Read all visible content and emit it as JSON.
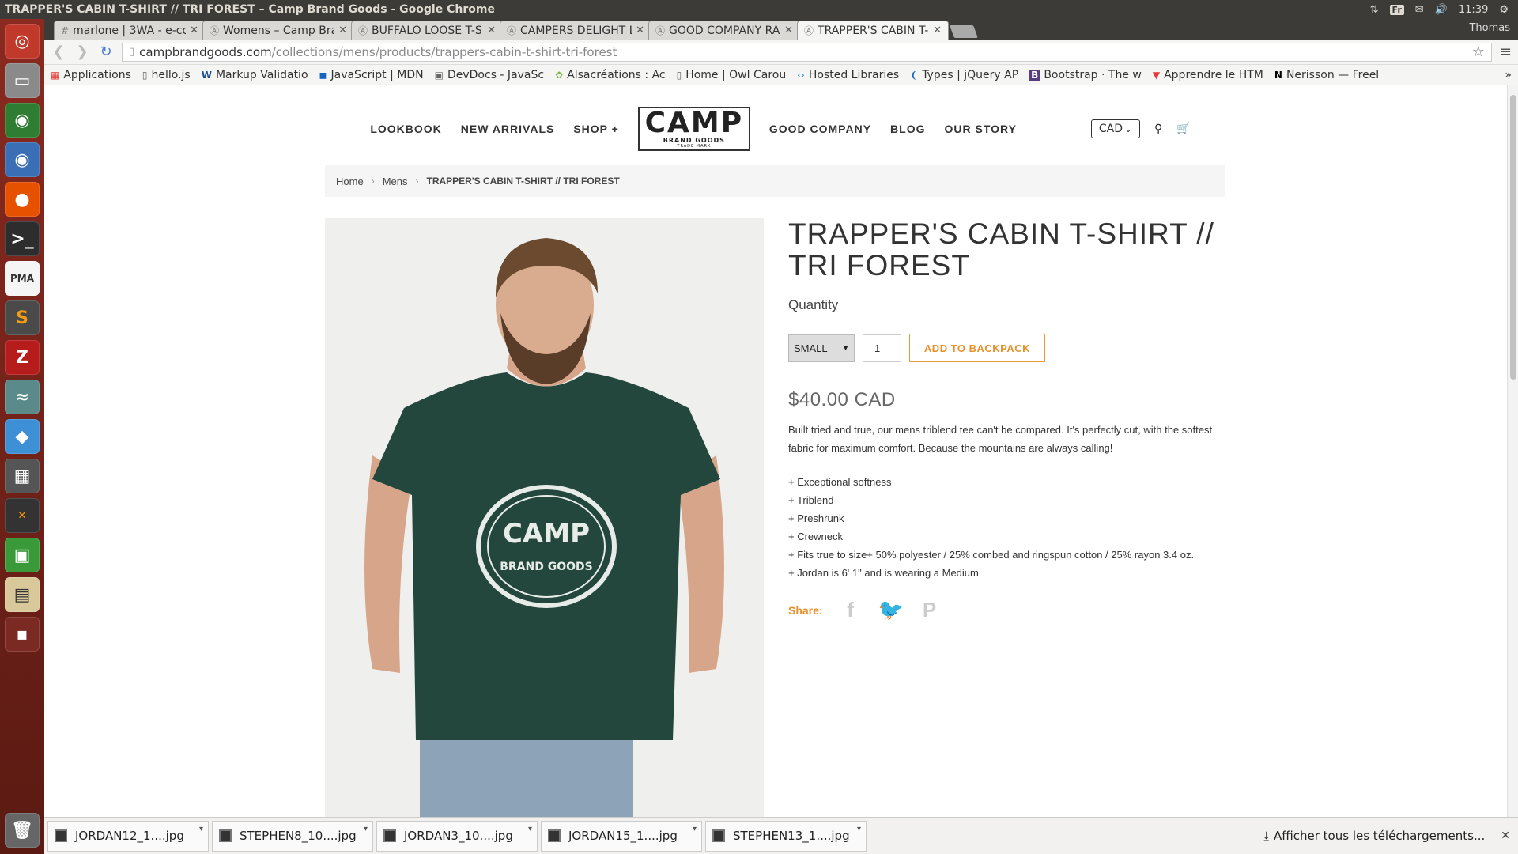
{
  "os": {
    "window_title": "TRAPPER'S CABIN T-SHIRT // TRI FOREST – Camp Brand Goods - Google Chrome",
    "keyboard_layout": "Fr",
    "clock": "11:39",
    "user": "Thomas"
  },
  "browser": {
    "tabs": [
      {
        "label": "marlone | 3WA - e-co",
        "active": false
      },
      {
        "label": "Womens – Camp Bra",
        "active": false
      },
      {
        "label": "BUFFALO LOOSE T-S",
        "active": false
      },
      {
        "label": "CAMPERS DELIGHT L",
        "active": false
      },
      {
        "label": "GOOD COMPANY RA",
        "active": false
      },
      {
        "label": "TRAPPER'S CABIN T-",
        "active": true
      }
    ],
    "url_domain": "campbrandgoods.com",
    "url_path": "/collections/mens/products/trappers-cabin-t-shirt-tri-forest",
    "bookmarks": [
      "Applications",
      "hello.js",
      "Markup Validatio",
      "JavaScript | MDN",
      "DevDocs - JavaSc",
      "Alsacréations : Ac",
      "Home | Owl Carou",
      "Hosted Libraries",
      "Types | jQuery AP",
      "Bootstrap · The w",
      "Apprendre le HTM",
      "Nerisson — Freel"
    ]
  },
  "site": {
    "nav_left": [
      "LOOKBOOK",
      "NEW ARRIVALS",
      "SHOP +"
    ],
    "nav_right": [
      "GOOD COMPANY",
      "BLOG",
      "OUR STORY"
    ],
    "logo_main": "CAMP",
    "logo_sub": "BRAND GOODS",
    "logo_mark": "TRADE MARK",
    "currency": "CAD"
  },
  "breadcrumb": {
    "home": "Home",
    "category": "Mens",
    "current": "TRAPPER'S CABIN T-SHIRT // TRI FOREST"
  },
  "product": {
    "title": "TRAPPER'S CABIN T-SHIRT // TRI FOREST",
    "quantity_label": "Quantity",
    "size_selected": "SMALL",
    "quantity_value": "1",
    "add_button": "ADD TO BACKPACK",
    "price": "$40.00 CAD",
    "description": "Built tried and true, our mens triblend tee can't be compared. It's perfectly cut, with the softest fabric for maximum comfort. Because the mountains are always calling!",
    "features": [
      "+ Exceptional softness",
      "+ Triblend",
      "+ Preshrunk",
      "+ Crewneck",
      "+ Fits true to size+ 50% polyester / 25% combed and ringspun cotton / 25% rayon 3.4 oz.",
      "+ Jordan is 6' 1\" and is wearing a Medium"
    ],
    "share_label": "Share:",
    "shirt_print_top": "CAMP",
    "shirt_print_bottom": "BRAND GOODS",
    "shirt_color": "#23473d"
  },
  "downloads": {
    "items": [
      "JORDAN12_1....jpg",
      "STEPHEN8_10....jpg",
      "JORDAN3_10....jpg",
      "JORDAN15_1....jpg",
      "STEPHEN13_1....jpg"
    ],
    "show_all": "Afficher tous les téléchargements..."
  }
}
